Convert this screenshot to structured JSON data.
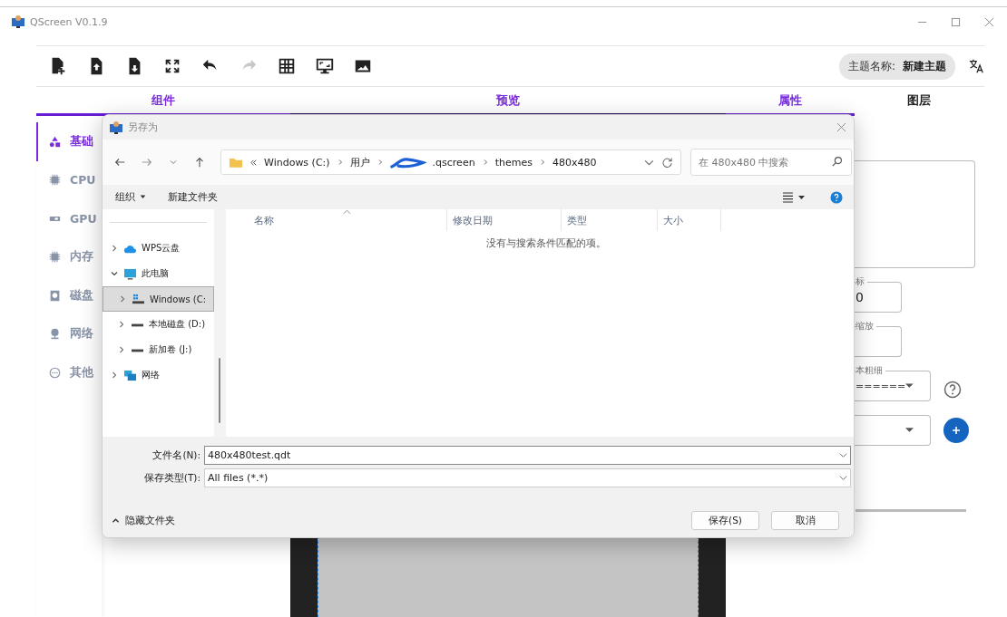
{
  "window": {
    "title": "QScreen V0.1.9"
  },
  "toolbar": {
    "tools": [
      {
        "kind": "new-file",
        "disabled": false
      },
      {
        "kind": "upload-file",
        "disabled": false
      },
      {
        "kind": "download-file",
        "disabled": false
      },
      {
        "kind": "fit",
        "disabled": false
      },
      {
        "kind": "undo",
        "disabled": false
      },
      {
        "kind": "redo",
        "disabled": true
      },
      {
        "kind": "grid",
        "disabled": false
      },
      {
        "kind": "screen",
        "disabled": false
      },
      {
        "kind": "image",
        "disabled": false
      }
    ],
    "theme_name": {
      "label": "主题名称:",
      "value": "新建主题"
    }
  },
  "panel_tabs": [
    {
      "label": "组件",
      "selected": true
    },
    {
      "label": "预览",
      "selected": true
    },
    {
      "label": "属性",
      "selected": true
    },
    {
      "label": "图层",
      "selected": false
    }
  ],
  "sidebar": {
    "items": [
      {
        "label": "基础",
        "kind": "shapes",
        "selected": true
      },
      {
        "label": "CPU",
        "kind": "chip",
        "selected": false
      },
      {
        "label": "GPU",
        "kind": "card",
        "selected": false
      },
      {
        "label": "内存",
        "kind": "chip",
        "selected": false
      },
      {
        "label": "磁盘",
        "kind": "disk",
        "selected": false
      },
      {
        "label": "网络",
        "kind": "globe",
        "selected": false
      },
      {
        "label": "其他",
        "kind": "more",
        "selected": false
      }
    ]
  },
  "properties": {
    "fields": [
      {
        "kind": "input",
        "label": "标",
        "value": "0"
      },
      {
        "kind": "input",
        "label": "缩放"
      },
      {
        "kind": "select",
        "label": "本粗细",
        "value": "======",
        "help": true
      },
      {
        "kind": "select",
        "add": true
      }
    ]
  },
  "dialog": {
    "title": "另存为",
    "address": {
      "crumbs": [
        "Windows (C:)",
        "用户",
        ".qscreen",
        "themes",
        "480x480"
      ]
    },
    "search": {
      "placeholder": "在 480x480 中搜索"
    },
    "commands": [
      {
        "label": "组织",
        "menu": true
      },
      {
        "label": "新建文件夹",
        "menu": false
      }
    ],
    "tree": [
      {
        "label": "WPS云盘",
        "kind": "cloud",
        "expanded": false,
        "selected": false
      },
      {
        "label": "此电脑",
        "kind": "pc",
        "expanded": true,
        "selected": false,
        "children": [
          {
            "label": "Windows (C:",
            "kind": "os-drive",
            "expanded": false,
            "selected": true
          },
          {
            "label": "本地磁盘 (D:)",
            "kind": "drive",
            "expanded": false,
            "selected": false
          },
          {
            "label": "新加卷 (J:)",
            "kind": "drive",
            "expanded": false,
            "selected": false
          }
        ]
      },
      {
        "label": "网络",
        "kind": "network",
        "expanded": false,
        "selected": false
      }
    ],
    "columns": [
      "名称",
      "修改日期",
      "类型",
      "大小"
    ],
    "empty_message": "没有与搜索条件匹配的项。",
    "file_name": {
      "label": "文件名(N):",
      "value": "480x480test.qdt"
    },
    "file_type": {
      "label": "保存类型(T):",
      "value": "All files (*.*)"
    },
    "hide_folders": "隐藏文件夹",
    "buttons": [
      "保存(S)",
      "取消"
    ]
  }
}
